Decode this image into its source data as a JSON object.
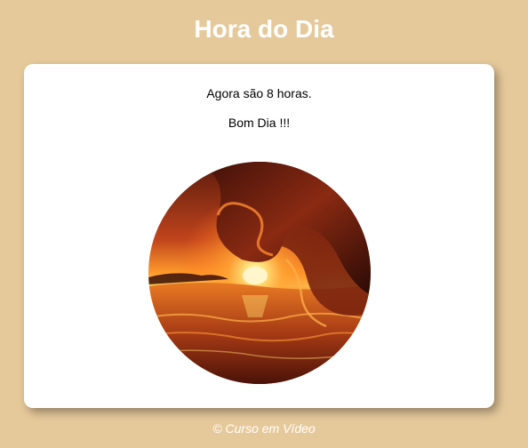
{
  "header": {
    "title": "Hora do Dia"
  },
  "card": {
    "message_time": "Agora são 8 horas.",
    "message_greeting": "Bom Dia !!!",
    "image": {
      "subject": "morning-sunset-wave-photo"
    }
  },
  "footer": {
    "credit": "© Curso em Vídeo"
  },
  "colors": {
    "background": "#e6c99b",
    "card": "#ffffff",
    "title_text": "#ffffff",
    "footer_text": "#ffffff"
  }
}
